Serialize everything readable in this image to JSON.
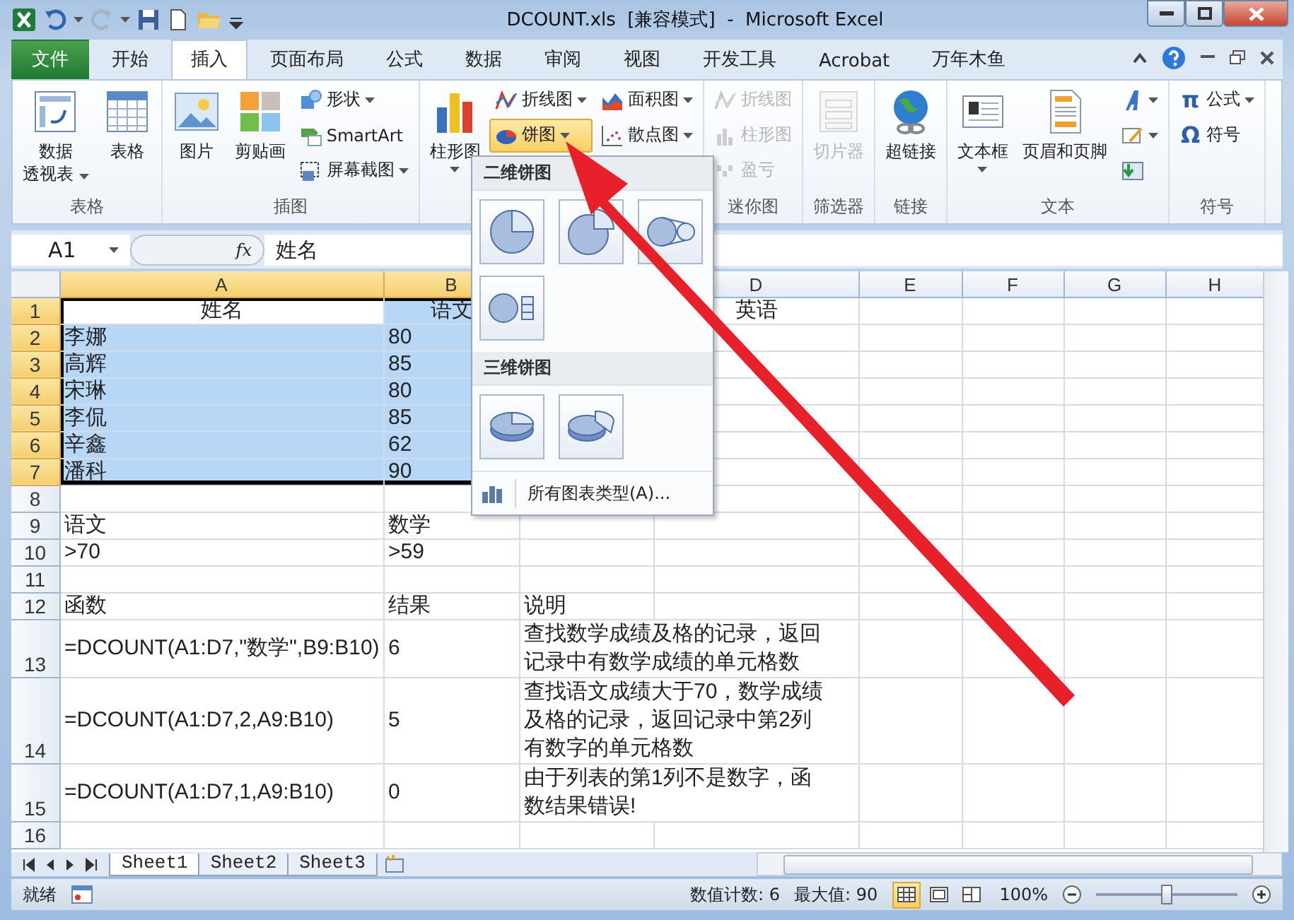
{
  "window": {
    "title": "DCOUNT.xls  [兼容模式]  -  Microsoft Excel"
  },
  "ribbon_tabs": [
    {
      "label": "文件",
      "kind": "file",
      "selected": false
    },
    {
      "label": "开始",
      "kind": "tab",
      "selected": false
    },
    {
      "label": "插入",
      "kind": "tab",
      "selected": true
    },
    {
      "label": "页面布局",
      "kind": "tab",
      "selected": false
    },
    {
      "label": "公式",
      "kind": "tab",
      "selected": false
    },
    {
      "label": "数据",
      "kind": "tab",
      "selected": false
    },
    {
      "label": "审阅",
      "kind": "tab",
      "selected": false
    },
    {
      "label": "视图",
      "kind": "tab",
      "selected": false
    },
    {
      "label": "开发工具",
      "kind": "tab",
      "selected": false
    },
    {
      "label": "Acrobat",
      "kind": "tab",
      "selected": false
    },
    {
      "label": "万年木鱼",
      "kind": "tab",
      "selected": false
    }
  ],
  "ribbon_groups": [
    {
      "label": "表格",
      "items": [
        {
          "kind": "large",
          "label_lines": [
            "数据",
            "透视表"
          ],
          "dropdown": true,
          "disabled": false
        },
        {
          "kind": "large",
          "label": "表格",
          "dropdown": false,
          "disabled": false
        }
      ]
    },
    {
      "label": "插图",
      "items": [
        {
          "kind": "large",
          "label": "图片",
          "dropdown": false,
          "disabled": false
        },
        {
          "kind": "large",
          "label": "剪贴画",
          "dropdown": false,
          "disabled": false
        },
        {
          "kind": "stack",
          "items": [
            {
              "label": "形状",
              "dropdown": true,
              "disabled": false,
              "pressed": false
            },
            {
              "label": "SmartArt",
              "dropdown": false,
              "disabled": false,
              "pressed": false
            },
            {
              "label": "屏幕截图",
              "dropdown": true,
              "disabled": false,
              "pressed": false
            }
          ]
        }
      ]
    },
    {
      "items": [
        {
          "kind": "large",
          "label": "柱形图",
          "dropdown": true,
          "disabled": false
        },
        {
          "kind": "stack",
          "items": [
            {
              "label": "折线图",
              "dropdown": true,
              "disabled": false,
              "pressed": false
            },
            {
              "label": "饼图",
              "dropdown": true,
              "disabled": false,
              "pressed": true
            }
          ]
        },
        {
          "kind": "stack",
          "items": [
            {
              "label": "面积图",
              "dropdown": true,
              "disabled": false,
              "pressed": false
            },
            {
              "label": "散点图",
              "dropdown": true,
              "disabled": false,
              "pressed": false
            }
          ]
        }
      ]
    },
    {
      "label": "迷你图",
      "items": [
        {
          "kind": "stack",
          "items": [
            {
              "label": "折线图",
              "dropdown": false,
              "disabled": true,
              "pressed": false
            },
            {
              "label": "柱形图",
              "dropdown": false,
              "disabled": true,
              "pressed": false
            },
            {
              "label": "盈亏",
              "dropdown": false,
              "disabled": true,
              "pressed": false
            }
          ]
        }
      ]
    },
    {
      "label": "筛选器",
      "items": [
        {
          "kind": "large",
          "label": "切片器",
          "dropdown": false,
          "disabled": true
        }
      ]
    },
    {
      "label": "链接",
      "items": [
        {
          "kind": "large",
          "label": "超链接",
          "dropdown": false,
          "disabled": false
        }
      ]
    },
    {
      "label": "文本",
      "items": [
        {
          "kind": "large",
          "label": "文本框",
          "dropdown": true,
          "disabled": false
        },
        {
          "kind": "large",
          "label": "页眉和页脚",
          "dropdown": false,
          "disabled": false
        },
        {
          "kind": "stack",
          "items": [
            {
              "dropdown": true,
              "disabled": false,
              "pressed": false
            },
            {
              "dropdown": true,
              "disabled": false,
              "pressed": false
            },
            {
              "dropdown": false,
              "disabled": false,
              "pressed": false
            }
          ]
        }
      ]
    },
    {
      "label": "符号",
      "items": [
        {
          "kind": "stack",
          "items": [
            {
              "glyph": "π",
              "label": "公式",
              "dropdown": true,
              "disabled": false,
              "pressed": false
            },
            {
              "glyph": "Ω",
              "label": "符号",
              "dropdown": false,
              "disabled": false,
              "pressed": false
            }
          ]
        }
      ]
    }
  ],
  "formula_bar": {
    "name_box": "A1",
    "fx": "fx",
    "formula": "姓名"
  },
  "columns": [
    {
      "kind": "column",
      "label": "A",
      "selected": true
    },
    {
      "kind": "column",
      "label": "B",
      "selected": true
    },
    {
      "kind": "covered"
    },
    {
      "kind": "column",
      "label": "D",
      "selected": false
    },
    {
      "kind": "column",
      "label": "E",
      "selected": false
    },
    {
      "kind": "column",
      "label": "F",
      "selected": false
    },
    {
      "kind": "column",
      "label": "G",
      "selected": false
    },
    {
      "kind": "column",
      "label": "H",
      "selected": false
    }
  ],
  "rows": [
    {
      "number": "1",
      "kind": "header",
      "selected": true,
      "cells": {
        "A": "姓名",
        "B": "语文",
        "D": "英语"
      }
    },
    {
      "number": "2",
      "kind": "data",
      "selected": true,
      "cells": {
        "A": "李娜",
        "B": "80"
      }
    },
    {
      "number": "3",
      "kind": "data",
      "selected": true,
      "cells": {
        "A": "高辉",
        "B": "85"
      }
    },
    {
      "number": "4",
      "kind": "data",
      "selected": true,
      "cells": {
        "A": "宋琳",
        "B": "80"
      }
    },
    {
      "number": "5",
      "kind": "data",
      "selected": true,
      "cells": {
        "A": "李侃",
        "B": "85"
      }
    },
    {
      "number": "6",
      "kind": "data",
      "selected": true,
      "cells": {
        "A": "辛鑫",
        "B": "62"
      }
    },
    {
      "number": "7",
      "kind": "data",
      "selected": true,
      "cells": {
        "A": "潘科",
        "B": "90"
      }
    },
    {
      "number": "8",
      "kind": "data",
      "selected": false,
      "cells": {}
    },
    {
      "number": "9",
      "kind": "data",
      "selected": false,
      "cells": {
        "A": "语文",
        "B": "数学"
      }
    },
    {
      "number": "10",
      "kind": "data",
      "selected": false,
      "cells": {
        "A": ">70",
        "B": ">59"
      }
    },
    {
      "number": "11",
      "kind": "data",
      "selected": false,
      "cells": {}
    },
    {
      "number": "12",
      "kind": "data",
      "selected": false,
      "cells": {
        "A": "函数",
        "B": "结果",
        "C": "说明"
      }
    },
    {
      "number": "13",
      "kind": "formula",
      "selected": false,
      "cells": {
        "A": "=DCOUNT(A1:D7,\"数学\",B9:B10)",
        "B": "6",
        "C": "查找数学成绩及格的记录，返回记录中有数学成绩的单元格数"
      }
    },
    {
      "number": "14",
      "kind": "formula",
      "selected": false,
      "cells": {
        "A": "=DCOUNT(A1:D7,2,A9:B10)",
        "B": "5",
        "C": "查找语文成绩大于70，数学成绩及格的记录，返回记录中第2列有数字的单元格数"
      }
    },
    {
      "number": "15",
      "kind": "formula",
      "selected": false,
      "cells": {
        "A": "=DCOUNT(A1:D7,1,A9:B10)",
        "B": "0",
        "C": "由于列表的第1列不是数字，函数结果错误!"
      }
    },
    {
      "number": "16",
      "kind": "data",
      "selected": false,
      "cells": {}
    }
  ],
  "pie_menu": {
    "sections": [
      {
        "title": "二维饼图",
        "count_items": [
          {
            "kind": "pie"
          },
          {
            "kind": "exploded"
          },
          {
            "kind": "pie-of-pie"
          },
          {
            "kind": "bar-of-pie"
          }
        ]
      },
      {
        "title": "三维饼图",
        "count_items": [
          {
            "kind": "pie3d"
          },
          {
            "kind": "exploded3d"
          }
        ]
      }
    ],
    "footer": "所有图表类型(A)..."
  },
  "sheet_tabs": [
    {
      "label": "Sheet1",
      "selected": true
    },
    {
      "label": "Sheet2",
      "selected": false
    },
    {
      "label": "Sheet3",
      "selected": false
    }
  ],
  "status_bar": {
    "mode": "就绪",
    "count": "数值计数: 6",
    "max": "最大值: 90",
    "views": [
      {
        "selected": true
      },
      {
        "selected": false
      },
      {
        "selected": false
      }
    ],
    "zoom": "100%",
    "zoom_slider": {
      "level": 0.5
    }
  }
}
